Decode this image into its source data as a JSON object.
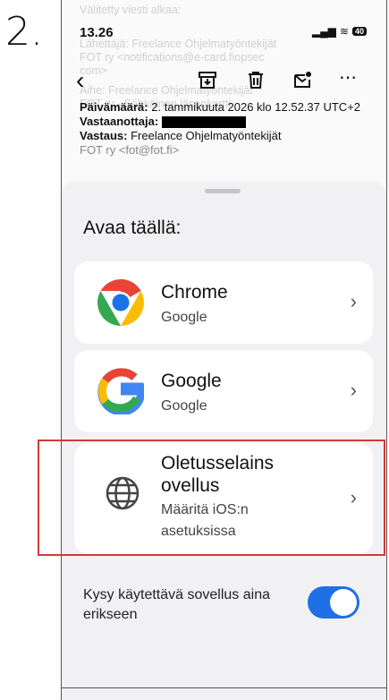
{
  "step_label": "2.",
  "status_bar": {
    "time": "13.26",
    "battery": "40"
  },
  "email": {
    "ghost_lines": [
      "Välitetty viesti alkaa:",
      "Lähettäjä: Freelance Ohjelmatyöntekijät",
      "FOT ry <notifications@e-card.fiopsec",
      "com>",
      "Aihe: Freelance Ohjelmatyöntekijät",
      "FOT ry - Sähköinen jäsenkortti"
    ],
    "date_label": "Päivämäärä:",
    "date_value": "2. tammikuuta 2026 klo 12.52.37 UTC+2",
    "to_label": "Vastaanottaja:",
    "reply_label": "Vastaus:",
    "reply_value": "Freelance Ohjelmatyöntekijät",
    "reply_value2": "FOT ry <fot@fot.fi>"
  },
  "sheet": {
    "title": "Avaa täällä:",
    "options": [
      {
        "name": "Chrome",
        "sub": "Google",
        "icon": "chrome-icon"
      },
      {
        "name": "Google",
        "sub": "Google",
        "icon": "google-icon"
      },
      {
        "name_line1": "Oletusselains",
        "name_line2": "ovellus",
        "sub_line1": "Määritä iOS:n",
        "sub_line2": "asetuksissa",
        "icon": "globe-icon"
      }
    ],
    "ask_label": "Kysy käytettävä sovellus aina erikseen",
    "ask_toggle": true,
    "toggle_color": "#1f6fe6"
  },
  "chevron": "›",
  "highlight_color": "#d23a3a"
}
